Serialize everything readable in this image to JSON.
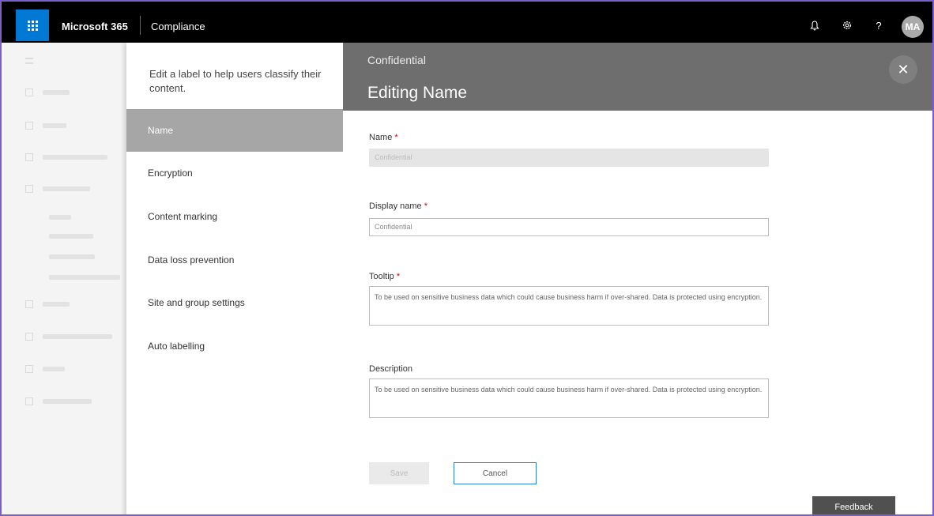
{
  "topbar": {
    "brand": "Microsoft 365",
    "app_name": "Compliance",
    "user_initials": "MA",
    "icons": [
      "waffle-icon",
      "bell-icon",
      "gear-icon",
      "help-icon"
    ],
    "help_glyph": "?"
  },
  "wizard": {
    "intro": "Edit a label to help users classify their content.",
    "steps": [
      {
        "label": "Name",
        "active": true
      },
      {
        "label": "Encryption",
        "active": false
      },
      {
        "label": "Content marking",
        "active": false
      },
      {
        "label": "Data loss prevention",
        "active": false
      },
      {
        "label": "Site and group settings",
        "active": false
      },
      {
        "label": "Auto labelling",
        "active": false
      }
    ]
  },
  "header": {
    "subtitle": "Confidential",
    "title": "Editing Name",
    "close_glyph": "✕"
  },
  "form": {
    "name_label": "Name",
    "name_value": "Confidential",
    "display_name_label": "Display name",
    "display_name_value": "Confidential",
    "tooltip_label": "Tooltip",
    "tooltip_value": "To be used on sensitive business data which could cause business harm if over-shared. Data is protected using encryption.",
    "description_label": "Description",
    "description_value": "To be used on sensitive business data which could cause business harm if over-shared. Data is protected using encryption.",
    "required_marker": "*"
  },
  "actions": {
    "save_label": "Save",
    "cancel_label": "Cancel"
  },
  "feedback_label": "Feedback",
  "colors": {
    "accent": "#0078d4",
    "topbar": "#000000",
    "header": "#6e6e6e",
    "active_step": "#a6a6a6",
    "required": "#cc0000"
  }
}
